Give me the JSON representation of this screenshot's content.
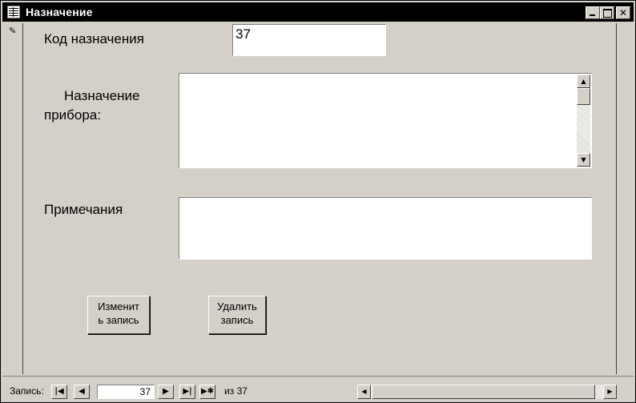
{
  "window": {
    "title": "Назначение",
    "icons": {
      "app": "table-icon",
      "minimize": "minimize-icon",
      "maximize": "maximize-icon",
      "close": "close-icon"
    }
  },
  "record_selector": {
    "icon": "pencil-icon",
    "glyph": "✎"
  },
  "form": {
    "code": {
      "label": "Код назначения",
      "value": "37"
    },
    "purpose": {
      "label_line1": "Назначение",
      "label_line2": "прибора:",
      "value": ""
    },
    "notes": {
      "label": "Примечания",
      "value": ""
    },
    "edit_button": {
      "line1": "Изменит",
      "line2": "ь запись"
    },
    "delete_button": {
      "line1": "Удалить",
      "line2": "запись"
    }
  },
  "navigation": {
    "label": "Запись:",
    "current": "37",
    "of_text": "из",
    "total": "37"
  },
  "colors": {
    "face": "#d4d0c8",
    "titlebar": "#000000",
    "field": "#ffffff"
  }
}
